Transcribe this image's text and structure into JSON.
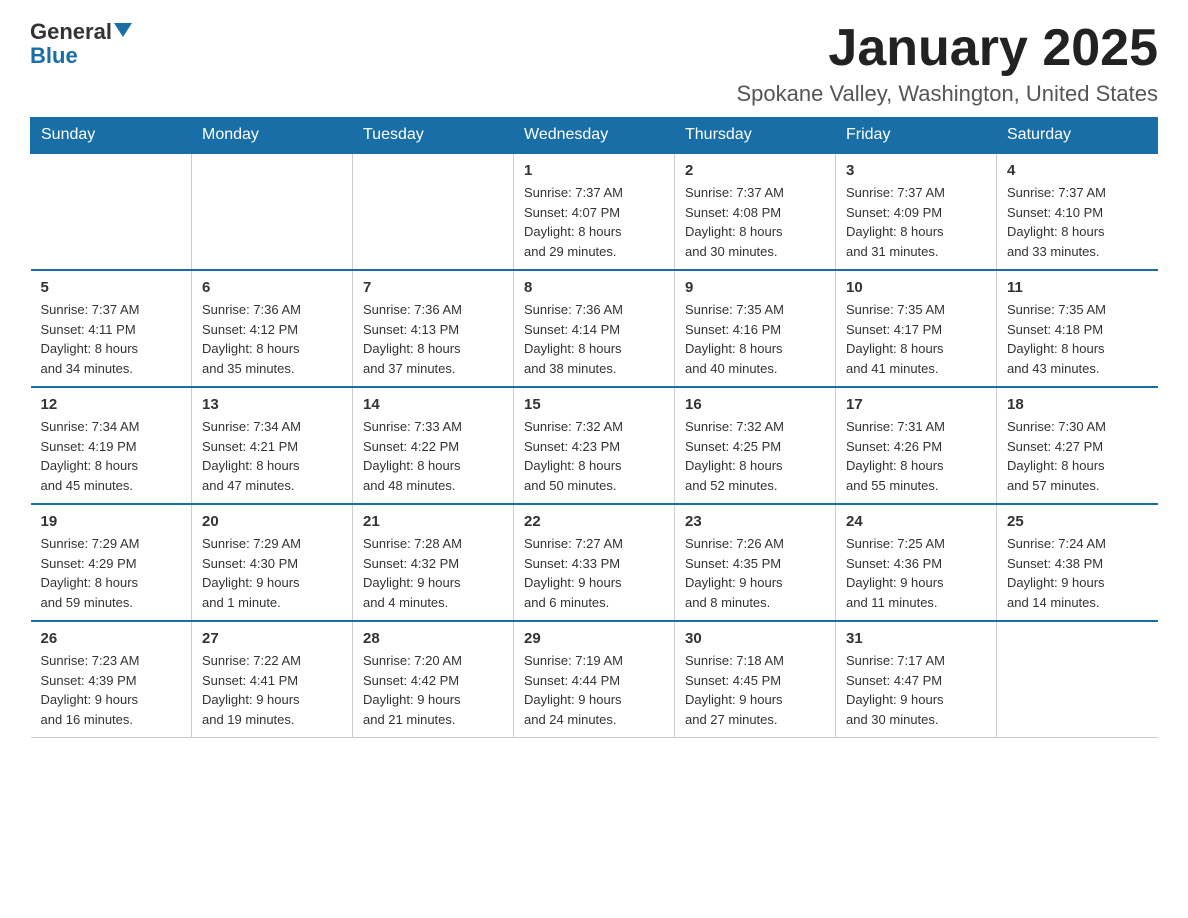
{
  "header": {
    "logo_text_general": "General",
    "logo_text_blue": "Blue",
    "title": "January 2025",
    "subtitle": "Spokane Valley, Washington, United States"
  },
  "days_of_week": [
    "Sunday",
    "Monday",
    "Tuesday",
    "Wednesday",
    "Thursday",
    "Friday",
    "Saturday"
  ],
  "weeks": [
    [
      {
        "day": "",
        "info": ""
      },
      {
        "day": "",
        "info": ""
      },
      {
        "day": "",
        "info": ""
      },
      {
        "day": "1",
        "info": "Sunrise: 7:37 AM\nSunset: 4:07 PM\nDaylight: 8 hours\nand 29 minutes."
      },
      {
        "day": "2",
        "info": "Sunrise: 7:37 AM\nSunset: 4:08 PM\nDaylight: 8 hours\nand 30 minutes."
      },
      {
        "day": "3",
        "info": "Sunrise: 7:37 AM\nSunset: 4:09 PM\nDaylight: 8 hours\nand 31 minutes."
      },
      {
        "day": "4",
        "info": "Sunrise: 7:37 AM\nSunset: 4:10 PM\nDaylight: 8 hours\nand 33 minutes."
      }
    ],
    [
      {
        "day": "5",
        "info": "Sunrise: 7:37 AM\nSunset: 4:11 PM\nDaylight: 8 hours\nand 34 minutes."
      },
      {
        "day": "6",
        "info": "Sunrise: 7:36 AM\nSunset: 4:12 PM\nDaylight: 8 hours\nand 35 minutes."
      },
      {
        "day": "7",
        "info": "Sunrise: 7:36 AM\nSunset: 4:13 PM\nDaylight: 8 hours\nand 37 minutes."
      },
      {
        "day": "8",
        "info": "Sunrise: 7:36 AM\nSunset: 4:14 PM\nDaylight: 8 hours\nand 38 minutes."
      },
      {
        "day": "9",
        "info": "Sunrise: 7:35 AM\nSunset: 4:16 PM\nDaylight: 8 hours\nand 40 minutes."
      },
      {
        "day": "10",
        "info": "Sunrise: 7:35 AM\nSunset: 4:17 PM\nDaylight: 8 hours\nand 41 minutes."
      },
      {
        "day": "11",
        "info": "Sunrise: 7:35 AM\nSunset: 4:18 PM\nDaylight: 8 hours\nand 43 minutes."
      }
    ],
    [
      {
        "day": "12",
        "info": "Sunrise: 7:34 AM\nSunset: 4:19 PM\nDaylight: 8 hours\nand 45 minutes."
      },
      {
        "day": "13",
        "info": "Sunrise: 7:34 AM\nSunset: 4:21 PM\nDaylight: 8 hours\nand 47 minutes."
      },
      {
        "day": "14",
        "info": "Sunrise: 7:33 AM\nSunset: 4:22 PM\nDaylight: 8 hours\nand 48 minutes."
      },
      {
        "day": "15",
        "info": "Sunrise: 7:32 AM\nSunset: 4:23 PM\nDaylight: 8 hours\nand 50 minutes."
      },
      {
        "day": "16",
        "info": "Sunrise: 7:32 AM\nSunset: 4:25 PM\nDaylight: 8 hours\nand 52 minutes."
      },
      {
        "day": "17",
        "info": "Sunrise: 7:31 AM\nSunset: 4:26 PM\nDaylight: 8 hours\nand 55 minutes."
      },
      {
        "day": "18",
        "info": "Sunrise: 7:30 AM\nSunset: 4:27 PM\nDaylight: 8 hours\nand 57 minutes."
      }
    ],
    [
      {
        "day": "19",
        "info": "Sunrise: 7:29 AM\nSunset: 4:29 PM\nDaylight: 8 hours\nand 59 minutes."
      },
      {
        "day": "20",
        "info": "Sunrise: 7:29 AM\nSunset: 4:30 PM\nDaylight: 9 hours\nand 1 minute."
      },
      {
        "day": "21",
        "info": "Sunrise: 7:28 AM\nSunset: 4:32 PM\nDaylight: 9 hours\nand 4 minutes."
      },
      {
        "day": "22",
        "info": "Sunrise: 7:27 AM\nSunset: 4:33 PM\nDaylight: 9 hours\nand 6 minutes."
      },
      {
        "day": "23",
        "info": "Sunrise: 7:26 AM\nSunset: 4:35 PM\nDaylight: 9 hours\nand 8 minutes."
      },
      {
        "day": "24",
        "info": "Sunrise: 7:25 AM\nSunset: 4:36 PM\nDaylight: 9 hours\nand 11 minutes."
      },
      {
        "day": "25",
        "info": "Sunrise: 7:24 AM\nSunset: 4:38 PM\nDaylight: 9 hours\nand 14 minutes."
      }
    ],
    [
      {
        "day": "26",
        "info": "Sunrise: 7:23 AM\nSunset: 4:39 PM\nDaylight: 9 hours\nand 16 minutes."
      },
      {
        "day": "27",
        "info": "Sunrise: 7:22 AM\nSunset: 4:41 PM\nDaylight: 9 hours\nand 19 minutes."
      },
      {
        "day": "28",
        "info": "Sunrise: 7:20 AM\nSunset: 4:42 PM\nDaylight: 9 hours\nand 21 minutes."
      },
      {
        "day": "29",
        "info": "Sunrise: 7:19 AM\nSunset: 4:44 PM\nDaylight: 9 hours\nand 24 minutes."
      },
      {
        "day": "30",
        "info": "Sunrise: 7:18 AM\nSunset: 4:45 PM\nDaylight: 9 hours\nand 27 minutes."
      },
      {
        "day": "31",
        "info": "Sunrise: 7:17 AM\nSunset: 4:47 PM\nDaylight: 9 hours\nand 30 minutes."
      },
      {
        "day": "",
        "info": ""
      }
    ]
  ]
}
